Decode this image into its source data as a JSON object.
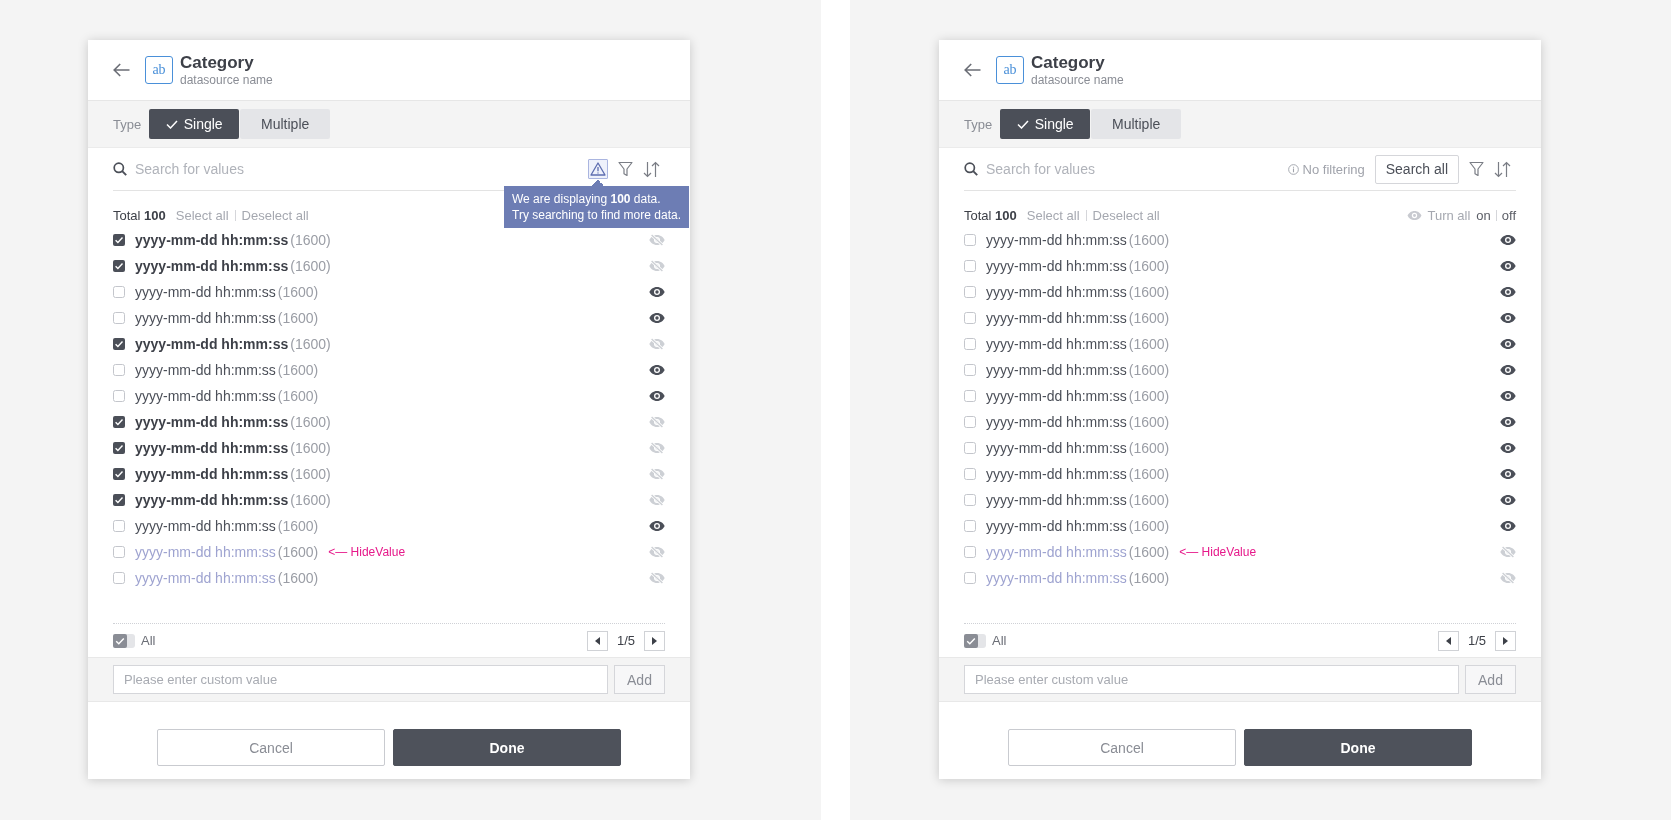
{
  "panels": [
    {
      "header": {
        "icon_text": "ab",
        "title": "Category",
        "subtitle": "datasource name"
      },
      "type": {
        "label": "Type",
        "options": [
          {
            "label": "Single",
            "selected": true
          },
          {
            "label": "Multiple",
            "selected": false
          }
        ]
      },
      "search": {
        "placeholder": "Search for values",
        "tools": [
          {
            "kind": "warning",
            "active": true,
            "tooltip": "We are displaying **100** data.\nTry searching to find more data."
          },
          {
            "kind": "filter"
          },
          {
            "kind": "sort"
          }
        ]
      },
      "summary": {
        "total": "Total **100**",
        "select_all": "Select all",
        "deselect_all": "Deselect all"
      },
      "rows": [
        {
          "label": "yyyy-mm-dd hh:mm:ss",
          "count": "(1600)",
          "checked": true,
          "visible": false
        },
        {
          "label": "yyyy-mm-dd hh:mm:ss",
          "count": "(1600)",
          "checked": true,
          "visible": false
        },
        {
          "label": "yyyy-mm-dd hh:mm:ss",
          "count": "(1600)",
          "checked": false,
          "visible": true
        },
        {
          "label": "yyyy-mm-dd hh:mm:ss",
          "count": "(1600)",
          "checked": false,
          "visible": true
        },
        {
          "label": "yyyy-mm-dd hh:mm:ss",
          "count": "(1600)",
          "checked": true,
          "visible": false
        },
        {
          "label": "yyyy-mm-dd hh:mm:ss",
          "count": "(1600)",
          "checked": false,
          "visible": true
        },
        {
          "label": "yyyy-mm-dd hh:mm:ss",
          "count": "(1600)",
          "checked": false,
          "visible": true
        },
        {
          "label": "yyyy-mm-dd hh:mm:ss",
          "count": "(1600)",
          "checked": true,
          "visible": false
        },
        {
          "label": "yyyy-mm-dd hh:mm:ss",
          "count": "(1600)",
          "checked": true,
          "visible": false
        },
        {
          "label": "yyyy-mm-dd hh:mm:ss",
          "count": "(1600)",
          "checked": true,
          "visible": false
        },
        {
          "label": "yyyy-mm-dd hh:mm:ss",
          "count": "(1600)",
          "checked": true,
          "visible": false
        },
        {
          "label": "yyyy-mm-dd hh:mm:ss",
          "count": "(1600)",
          "checked": false,
          "visible": true
        },
        {
          "label": "yyyy-mm-dd hh:mm:ss",
          "count": "(1600)",
          "checked": false,
          "visible": false,
          "note": "<— HideValue"
        },
        {
          "label": "yyyy-mm-dd hh:mm:ss",
          "count": "(1600)",
          "checked": false,
          "visible": false
        }
      ],
      "footer": {
        "all": {
          "label": "All",
          "checked": true
        },
        "page": "1/5",
        "custom": {
          "placeholder": "Please enter custom value",
          "button": "Add"
        }
      },
      "actions": [
        {
          "kind": "secondary",
          "label": "Cancel"
        },
        {
          "kind": "primary",
          "label": "Done"
        }
      ]
    },
    {
      "header": {
        "icon_text": "ab",
        "title": "Category",
        "subtitle": "datasource name"
      },
      "type": {
        "label": "Type",
        "options": [
          {
            "label": "Single",
            "selected": true
          },
          {
            "label": "Multiple",
            "selected": false
          }
        ]
      },
      "search": {
        "placeholder": "Search for values",
        "tools": [
          {
            "kind": "note",
            "label": "No filtering"
          },
          {
            "kind": "button",
            "label": "Search all"
          },
          {
            "kind": "filter"
          },
          {
            "kind": "sort"
          }
        ]
      },
      "summary": {
        "total": "Total **100**",
        "select_all": "Select all",
        "deselect_all": "Deselect all",
        "visibility": {
          "label": "Turn all",
          "on": "on",
          "off": "off"
        }
      },
      "rows": [
        {
          "label": "yyyy-mm-dd hh:mm:ss",
          "count": "(1600)",
          "checked": false,
          "visible": true
        },
        {
          "label": "yyyy-mm-dd hh:mm:ss",
          "count": "(1600)",
          "checked": false,
          "visible": true
        },
        {
          "label": "yyyy-mm-dd hh:mm:ss",
          "count": "(1600)",
          "checked": false,
          "visible": true
        },
        {
          "label": "yyyy-mm-dd hh:mm:ss",
          "count": "(1600)",
          "checked": false,
          "visible": true
        },
        {
          "label": "yyyy-mm-dd hh:mm:ss",
          "count": "(1600)",
          "checked": false,
          "visible": true
        },
        {
          "label": "yyyy-mm-dd hh:mm:ss",
          "count": "(1600)",
          "checked": false,
          "visible": true
        },
        {
          "label": "yyyy-mm-dd hh:mm:ss",
          "count": "(1600)",
          "checked": false,
          "visible": true
        },
        {
          "label": "yyyy-mm-dd hh:mm:ss",
          "count": "(1600)",
          "checked": false,
          "visible": true
        },
        {
          "label": "yyyy-mm-dd hh:mm:ss",
          "count": "(1600)",
          "checked": false,
          "visible": true
        },
        {
          "label": "yyyy-mm-dd hh:mm:ss",
          "count": "(1600)",
          "checked": false,
          "visible": true
        },
        {
          "label": "yyyy-mm-dd hh:mm:ss",
          "count": "(1600)",
          "checked": false,
          "visible": true
        },
        {
          "label": "yyyy-mm-dd hh:mm:ss",
          "count": "(1600)",
          "checked": false,
          "visible": true
        },
        {
          "label": "yyyy-mm-dd hh:mm:ss",
          "count": "(1600)",
          "checked": false,
          "visible": false,
          "note": "<— HideValue"
        },
        {
          "label": "yyyy-mm-dd hh:mm:ss",
          "count": "(1600)",
          "checked": false,
          "visible": false
        }
      ],
      "footer": {
        "all": {
          "label": "All",
          "checked": true
        },
        "page": "1/5",
        "custom": {
          "placeholder": "Please enter custom value",
          "button": "Add"
        }
      },
      "actions": [
        {
          "kind": "secondary",
          "label": "Cancel"
        },
        {
          "kind": "primary",
          "label": "Done"
        }
      ]
    }
  ]
}
